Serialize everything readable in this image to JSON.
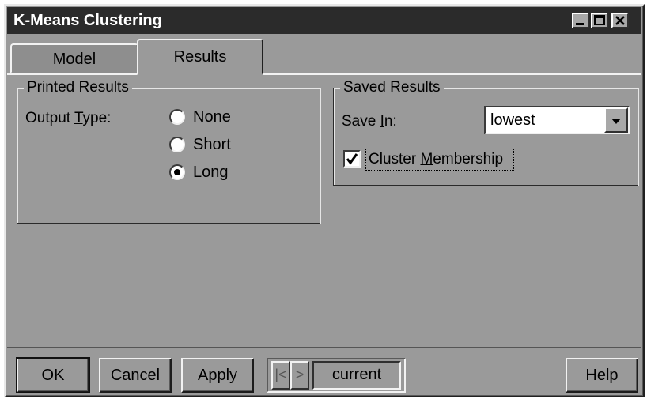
{
  "window": {
    "title": "K-Means Clustering"
  },
  "tabs": [
    {
      "label": "Model",
      "active": false
    },
    {
      "label": "Results",
      "active": true
    }
  ],
  "printed_results": {
    "legend": "Printed Results",
    "output_type": {
      "pre": "Output ",
      "accel": "T",
      "post": "ype:"
    },
    "options": [
      {
        "label": "None",
        "selected": false
      },
      {
        "label": "Short",
        "selected": false
      },
      {
        "label": "Long",
        "selected": true
      }
    ]
  },
  "saved_results": {
    "legend": "Saved Results",
    "save_in": {
      "pre": "Save ",
      "accel": "I",
      "post": "n:"
    },
    "save_in_value": "lowest",
    "cluster_membership": {
      "pre": "Cluster ",
      "accel": "M",
      "post": "embership",
      "checked": true
    }
  },
  "buttons": {
    "ok": "OK",
    "cancel": "Cancel",
    "apply": "Apply",
    "first": "|<",
    "next": ">",
    "current": "current",
    "help": "Help"
  }
}
